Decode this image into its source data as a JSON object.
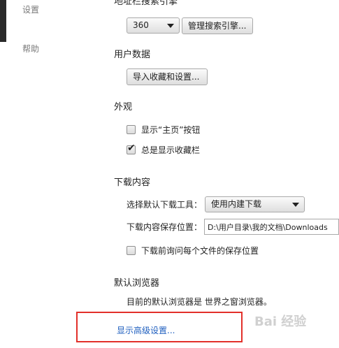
{
  "sidebar": {
    "items": [
      {
        "label": "设置"
      },
      {
        "label": "帮助"
      }
    ]
  },
  "search_section": {
    "title": "地址栏搜索引擎",
    "engine_select": {
      "value": "360"
    },
    "manage_button": "管理搜索引擎..."
  },
  "user_data_section": {
    "title": "用户数据",
    "import_button": "导入收藏和设置..."
  },
  "appearance_section": {
    "title": "外观",
    "show_home_button": {
      "label": "显示“主页”按钮",
      "checked": false
    },
    "show_bookmarks_bar": {
      "label": "总是显示收藏栏",
      "checked": true
    }
  },
  "downloads_section": {
    "title": "下载内容",
    "tool_label": "选择默认下载工具：",
    "tool_select": {
      "value": "使用内建下载"
    },
    "location_label": "下载内容保存位置：",
    "location_value": "D:\\用户目录\\我的文档\\Downloads",
    "ask_location": {
      "label": "下载前询问每个文件的保存位置",
      "checked": false
    }
  },
  "default_browser_section": {
    "title": "默认浏览器",
    "status": "目前的默认浏览器是 世界之窗浏览器。"
  },
  "advanced_link": "显示高级设置...",
  "watermark_text": "Bai 经验",
  "colors": {
    "link": "#1f5fbf",
    "highlight_box": "#e2302a"
  }
}
